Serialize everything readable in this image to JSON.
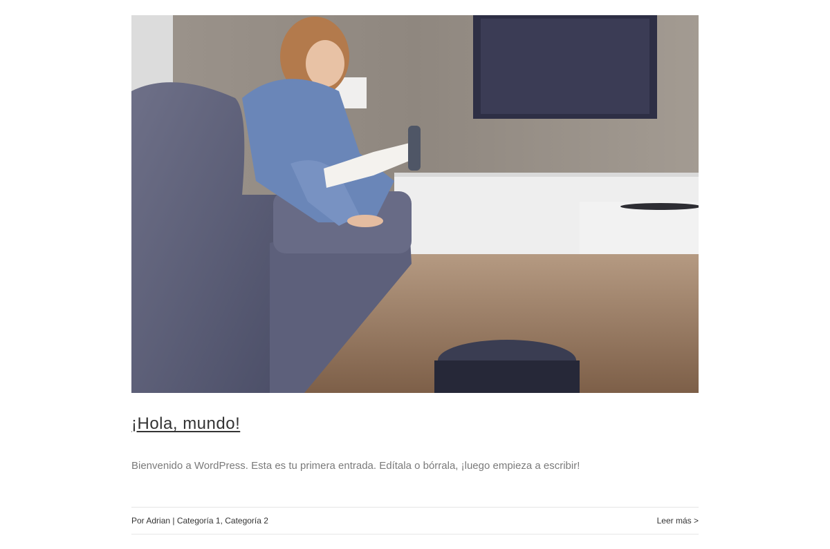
{
  "post": {
    "image_alt": "Mujer leyendo en un sofá mientras un robot aspirador limpia el suelo",
    "title": "¡Hola, mundo!",
    "excerpt": "Bienvenido a WordPress. Esta es tu primera entrada. Edítala o bórrala, ¡luego empieza a escribir!",
    "meta": {
      "by_prefix": "Por ",
      "author": "Adrian",
      "separator": " | ",
      "categories": [
        "Categoría 1",
        "Categoría 2"
      ],
      "category_sep": ", ",
      "read_more": "Leer más >"
    }
  },
  "colors": {
    "title": "#333333",
    "excerpt": "#7a7a7a",
    "divider": "#e6e6e6"
  }
}
